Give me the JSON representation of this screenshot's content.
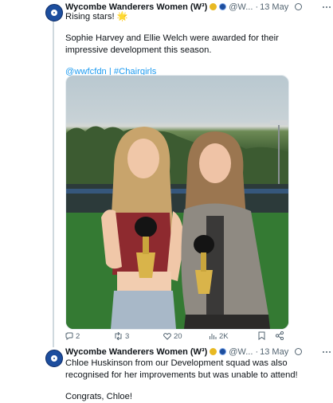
{
  "tweets": [
    {
      "author": "Wycombe Wanderers Women (W³)",
      "handle": "@W...",
      "separator": "·",
      "date": "13 May",
      "lines": [
        "Rising stars!",
        "Sophie Harvey and Ellie Welch were awarded for their",
        "impressive development this season."
      ],
      "spark": "🌟",
      "tags": "@wwfcfdn | #Chairgirls",
      "stats": {
        "replies": "2",
        "reposts": "3",
        "likes": "20",
        "views": "2K"
      },
      "media_alt_hint": "photo-of-two-players-holding-awards"
    },
    {
      "author": "Wycombe Wanderers Women (W³)",
      "handle": "@W...",
      "separator": "·",
      "date": "13 May",
      "lines": [
        "Chloe Huskinson from our Development squad was also",
        "recognised for her improvements but was unable to attend!",
        "Congrats, Chloe!"
      ]
    }
  ],
  "colors": {
    "link": "#1d9bf0",
    "muted": "#536471",
    "text": "#0f1419",
    "brand": "#1d4e9e"
  }
}
